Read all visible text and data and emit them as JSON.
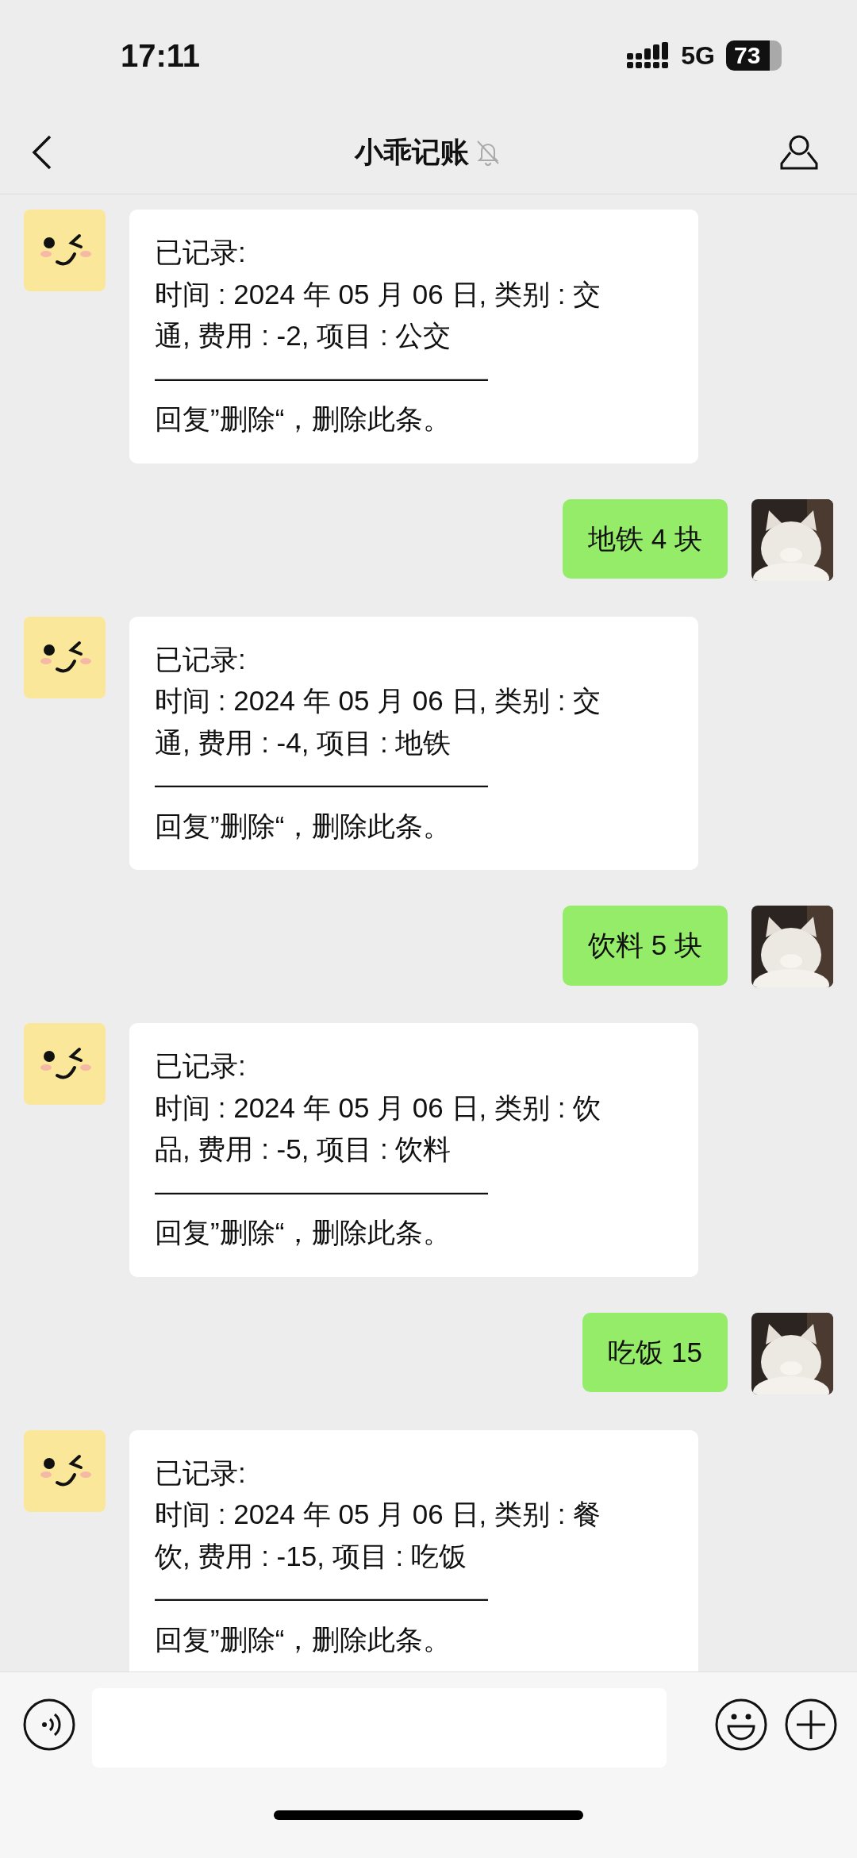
{
  "status_bar": {
    "time": "17:11",
    "network": "5G",
    "battery": "73"
  },
  "header": {
    "title": "小乖记账",
    "muted": true
  },
  "messages": [
    {
      "kind": "incoming",
      "lines": [
        "已记录:",
        "时间 : 2024 年 05 月 06 日, 类别 : 交",
        "通, 费用 : -2, 项目 : 公交",
        "————————————",
        "回复”删除“，删除此条。"
      ]
    },
    {
      "kind": "outgoing",
      "lines": [
        "地铁 4 块"
      ]
    },
    {
      "kind": "incoming",
      "lines": [
        "已记录:",
        "时间 : 2024 年 05 月 06 日, 类别 : 交",
        "通, 费用 : -4, 项目 : 地铁",
        "————————————",
        "回复”删除“，删除此条。"
      ]
    },
    {
      "kind": "outgoing",
      "lines": [
        "饮料 5 块"
      ]
    },
    {
      "kind": "incoming",
      "lines": [
        "已记录:",
        "时间 : 2024 年 05 月 06 日, 类别 : 饮",
        "品, 费用 : -5, 项目 : 饮料",
        "————————————",
        "回复”删除“，删除此条。"
      ]
    },
    {
      "kind": "outgoing",
      "lines": [
        "吃饭 15"
      ]
    },
    {
      "kind": "incoming",
      "lines": [
        "已记录:",
        "时间 : 2024 年 05 月 06 日, 类别 : 餐",
        "饮, 费用 : -15, 项目 : 吃饭",
        "————————————",
        "回复”删除“，删除此条。"
      ]
    }
  ]
}
